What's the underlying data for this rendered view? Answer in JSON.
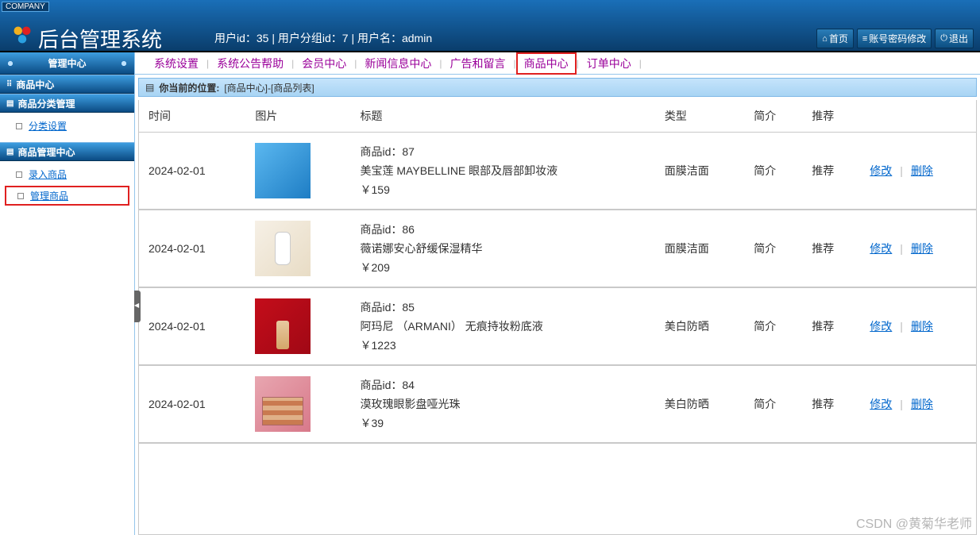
{
  "company_tag": "COMPANY",
  "system_title": "后台管理系统",
  "userinfo": "用户id：35 | 用户分组id：7 | 用户名：admin",
  "top_actions": {
    "home": "首页",
    "pwd": "账号密码修改",
    "logout": "退出"
  },
  "sidebar": {
    "header": "管理中心",
    "section1": "商品中心",
    "group1": {
      "title": "商品分类管理",
      "items": [
        "分类设置"
      ]
    },
    "group2": {
      "title": "商品管理中心",
      "items": [
        "录入商品",
        "管理商品"
      ]
    }
  },
  "topnav": [
    "系统设置",
    "系统公告帮助",
    "会员中心",
    "新闻信息中心",
    "广告和留言",
    "商品中心",
    "订单中心"
  ],
  "topnav_highlight_index": 5,
  "breadcrumb": {
    "label": "你当前的位置:",
    "path": "[商品中心]-[商品列表]"
  },
  "columns": [
    "时间",
    "图片",
    "标题",
    "类型",
    "简介",
    "推荐",
    ""
  ],
  "rows": [
    {
      "date": "2024-02-01",
      "id_line": "商品id：87",
      "name": "美宝莲 MAYBELLINE 眼部及唇部卸妆液",
      "price": "￥159",
      "type": "面膜洁面",
      "intro": "简介",
      "rec": "推荐"
    },
    {
      "date": "2024-02-01",
      "id_line": "商品id：86",
      "name": "薇诺娜安心舒缓保湿精华",
      "price": "￥209",
      "type": "面膜洁面",
      "intro": "简介",
      "rec": "推荐"
    },
    {
      "date": "2024-02-01",
      "id_line": "商品id：85",
      "name": "阿玛尼 （ARMANI） 无痕持妆粉底液",
      "price": "￥1223",
      "type": "美白防晒",
      "intro": "简介",
      "rec": "推荐"
    },
    {
      "date": "2024-02-01",
      "id_line": "商品id：84",
      "name": "漠玫瑰眼影盘哑光珠",
      "price": "￥39",
      "type": "美白防晒",
      "intro": "简介",
      "rec": "推荐"
    }
  ],
  "action_labels": {
    "edit": "修改",
    "del": "删除"
  },
  "watermark": "CSDN @黄菊华老师"
}
